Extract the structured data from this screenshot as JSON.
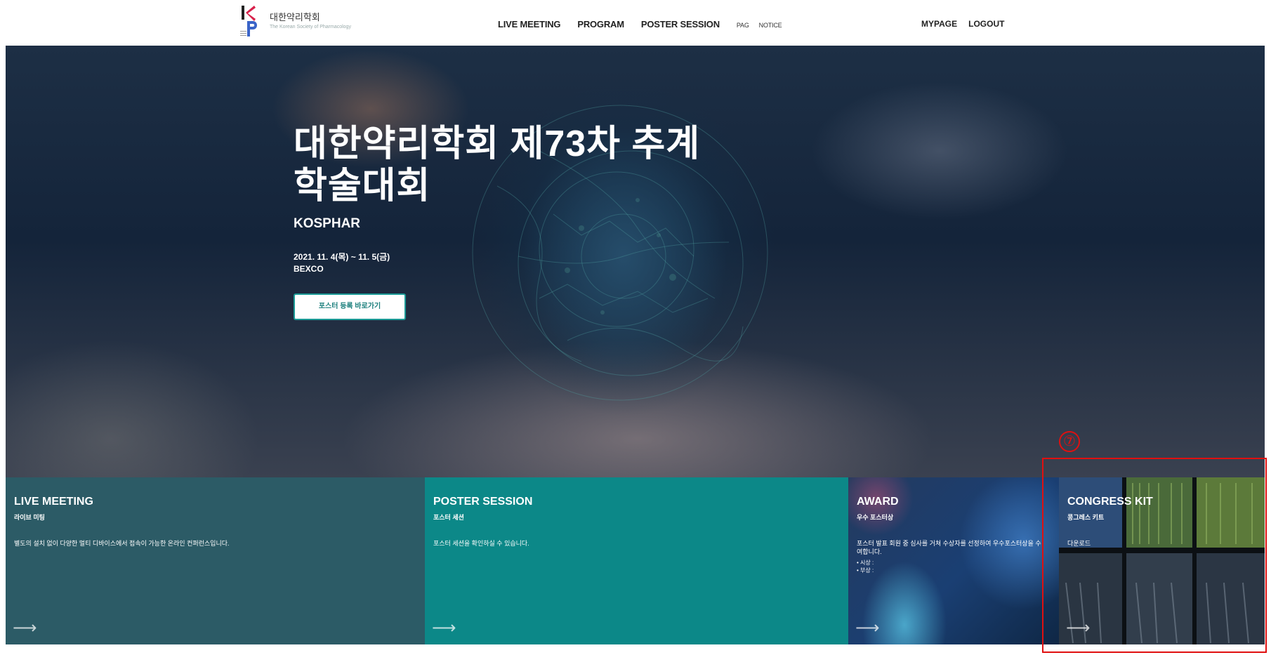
{
  "header": {
    "logo": {
      "name_ko": "대한약리학회",
      "name_en": "The Korean Society of Pharmacology"
    },
    "nav": [
      {
        "label": "LIVE MEETING"
      },
      {
        "label": "PROGRAM"
      },
      {
        "label": "POSTER SESSION"
      },
      {
        "label": "PAG"
      },
      {
        "label": "NOTICE"
      }
    ],
    "user_nav": [
      {
        "label": "MYPAGE"
      },
      {
        "label": "LOGOUT"
      }
    ]
  },
  "hero": {
    "title": "대한약리학회 제73차 추계학술대회",
    "subtitle": "KOSPHAR",
    "date": "2021. 11. 4(목) ~ 11. 5(금)",
    "venue": "BEXCO",
    "button_label": "포스터 등록 바로가기"
  },
  "panels": [
    {
      "title": "LIVE MEETING",
      "subtitle": "라이브 미팅",
      "description": "별도의 설치 없이 다양한 멀티 디바이스에서 접속이 가능한 온라인 컨퍼런스입니다.",
      "color": "#2c5b66"
    },
    {
      "title": "POSTER SESSION",
      "subtitle": "포스터 세션",
      "description": "포스터 세션을 확인하실 수 있습니다.",
      "color": "#0c8888"
    },
    {
      "title": "AWARD",
      "subtitle": "우수 포스터상",
      "description": "포스터 발표 회원 중 심사를 거쳐 수상자를 선정하여 우수포스터상을 수여합니다.",
      "list": [
        "• 시상 :",
        "• 부상 :"
      ]
    },
    {
      "title": "CONGRESS KIT",
      "subtitle": "콩그레스 키트",
      "description": "다운로드"
    }
  ],
  "annotation": {
    "number": "⑦",
    "color": "#e01010"
  },
  "icons": {
    "panel_arrow": "arrow-right-icon",
    "logo": "ksp-logo-icon"
  }
}
